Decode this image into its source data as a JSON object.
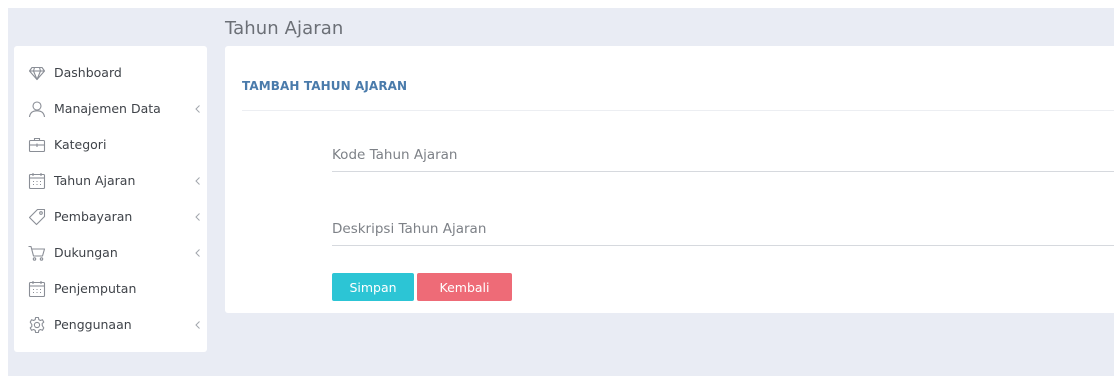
{
  "page": {
    "title": "Tahun Ajaran"
  },
  "sidebar": {
    "items": [
      {
        "label": "Dashboard",
        "icon": "diamond-icon",
        "has_submenu": false
      },
      {
        "label": "Manajemen Data",
        "icon": "user-icon",
        "has_submenu": true
      },
      {
        "label": "Kategori",
        "icon": "briefcase-icon",
        "has_submenu": false
      },
      {
        "label": "Tahun Ajaran",
        "icon": "calendar-icon",
        "has_submenu": true
      },
      {
        "label": "Pembayaran",
        "icon": "tag-icon",
        "has_submenu": true
      },
      {
        "label": "Dukungan",
        "icon": "cart-icon",
        "has_submenu": true
      },
      {
        "label": "Penjemputan",
        "icon": "calendar-icon",
        "has_submenu": false
      },
      {
        "label": "Penggunaan",
        "icon": "gear-icon",
        "has_submenu": true
      }
    ]
  },
  "form": {
    "header": "TAMBAH TAHUN AJARAN",
    "fields": {
      "kode_placeholder": "Kode Tahun Ajaran",
      "kode_value": "",
      "deskripsi_placeholder": "Deskripsi Tahun Ajaran",
      "deskripsi_value": ""
    },
    "buttons": {
      "save_label": "Simpan",
      "back_label": "Kembali"
    }
  },
  "colors": {
    "background": "#e9ecf4",
    "header_accent": "#4a7bab",
    "save_button": "#2cc5d5",
    "back_button": "#ee6b77",
    "icon_stroke": "#8a8e96"
  }
}
